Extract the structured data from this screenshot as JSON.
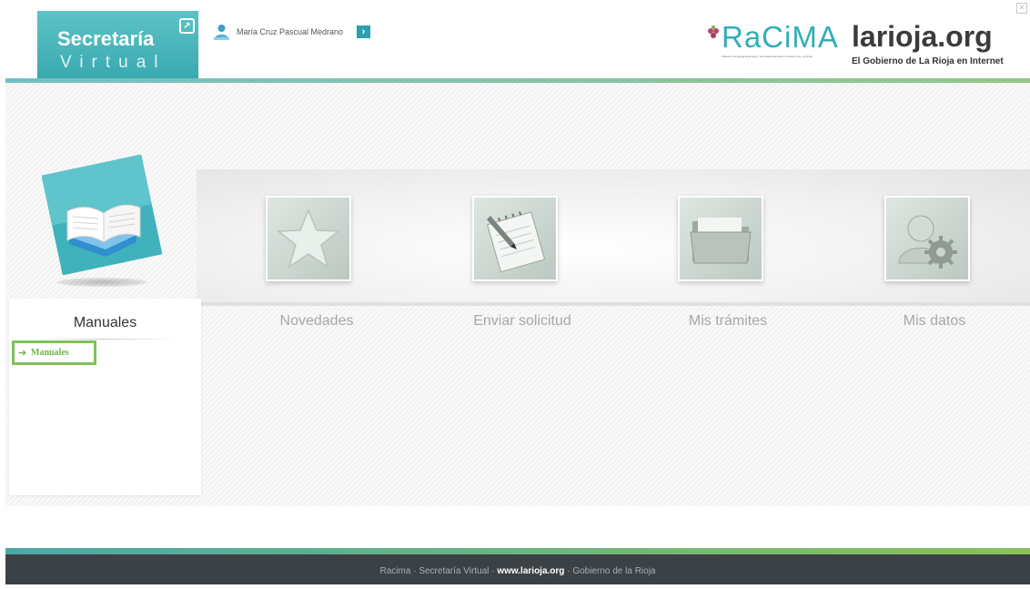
{
  "header": {
    "app_title": "Secretaría",
    "app_subtitle": "Virtual",
    "user_name": "María Cruz Pascual Medrano",
    "racima_name": "RaCiMA",
    "racima_tagline": "Plataforma Integral Educativa / Secretaría Educación Gobierno de La Rioja",
    "larioja_name": "larioja.org",
    "larioja_tagline": "El Gobierno de La Rioja en Internet"
  },
  "panel": {
    "title": "Manuales",
    "link_label": "Manuales"
  },
  "categories": [
    {
      "label": "Novedades",
      "icon": "star-icon"
    },
    {
      "label": "Enviar solicitud",
      "icon": "notepad-pencil-icon"
    },
    {
      "label": "Mis trámites",
      "icon": "folder-icon"
    },
    {
      "label": "Mis datos",
      "icon": "user-settings-icon"
    }
  ],
  "footer": {
    "item1": "Racima",
    "sep": "·",
    "item2": "Secretaría Virtual",
    "item3": "www.larioja.org",
    "item4": "Gobierno de la Rioja"
  },
  "colors": {
    "brand_teal": "#3aa9b0",
    "accent_green": "#7fc25a",
    "footer_bg": "#3b4145"
  }
}
